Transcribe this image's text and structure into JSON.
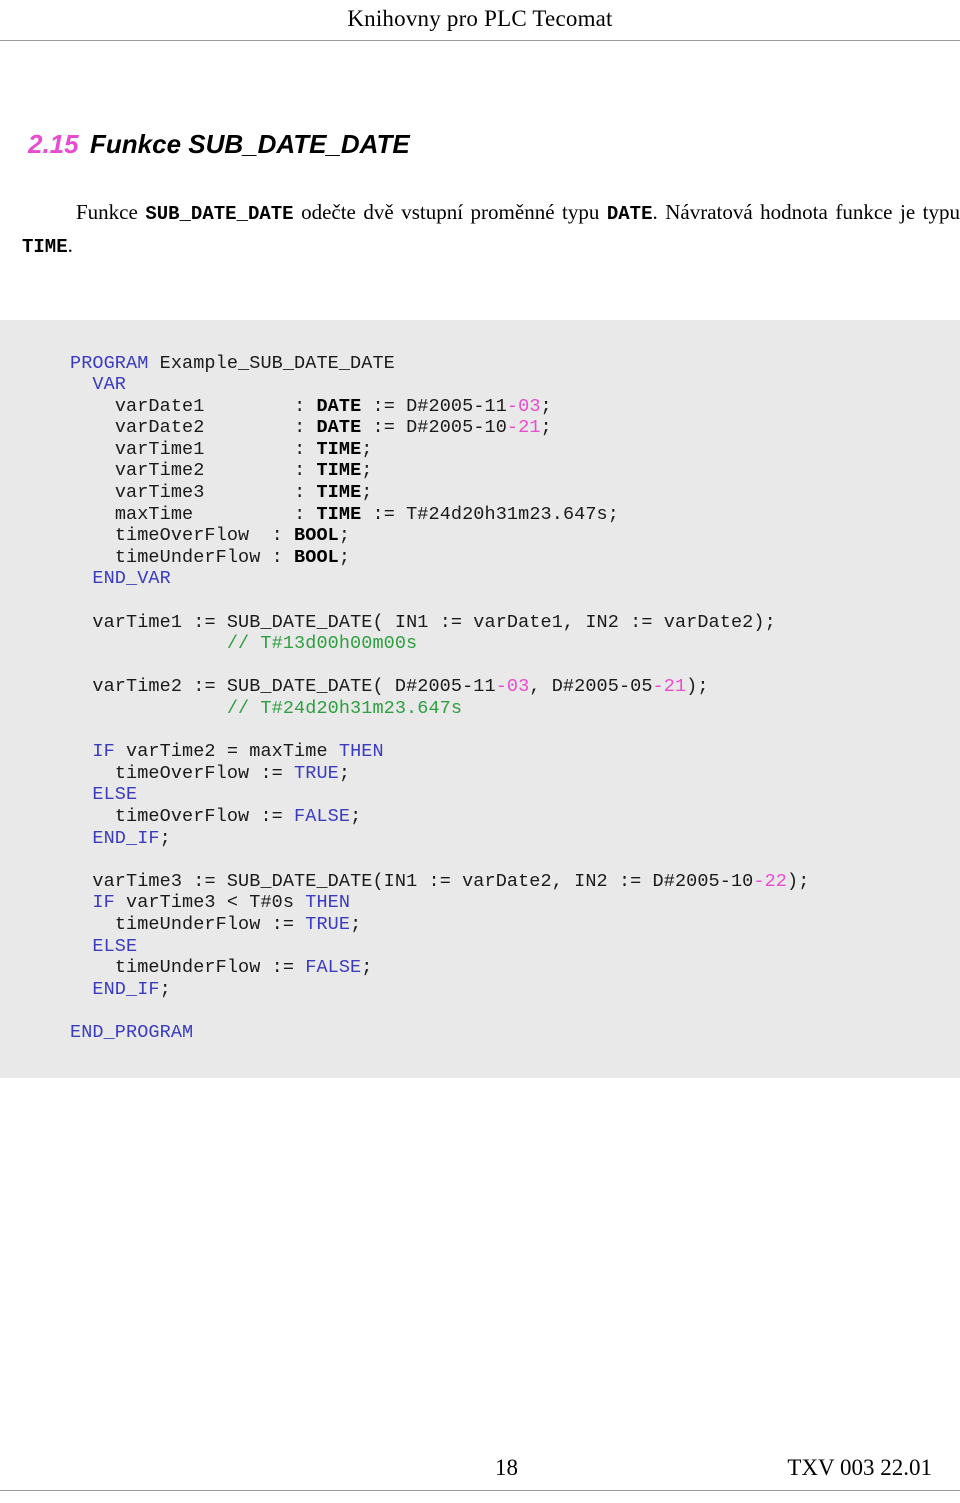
{
  "header": {
    "running_title": "Knihovny pro PLC Tecomat"
  },
  "heading": {
    "number": "2.15",
    "title": "Funkce SUB_DATE_DATE"
  },
  "intro": {
    "t1": "Funkce ",
    "code1": "SUB_DATE_DATE",
    "t2": " odečte dvě vstupní proměnné typu ",
    "code2": "DATE",
    "t3": ". Návratová hodnota funkce je typu ",
    "code3": "TIME",
    "t4": "."
  },
  "code": {
    "language": "Structured Text",
    "colors": {
      "background": "#e9e9e9",
      "keyword": "#3b3bbf",
      "type": "#000000",
      "number": "#e84bd0",
      "comment": "#2f9e41",
      "plain": "#1a1a1a"
    },
    "lines": [
      {
        "id": "l01",
        "text": "PROGRAM Example_SUB_DATE_DATE"
      },
      {
        "id": "l02",
        "text": "  VAR"
      },
      {
        "id": "l03",
        "text": "    varDate1        : DATE := D#2005-11-03;"
      },
      {
        "id": "l04",
        "text": "    varDate2        : DATE := D#2005-10-21;"
      },
      {
        "id": "l05",
        "text": "    varTime1        : TIME;"
      },
      {
        "id": "l06",
        "text": "    varTime2        : TIME;"
      },
      {
        "id": "l07",
        "text": "    varTime3        : TIME;"
      },
      {
        "id": "l08",
        "text": "    maxTime         : TIME := T#24d20h31m23.647s;"
      },
      {
        "id": "l09",
        "text": "    timeOverFlow  : BOOL;"
      },
      {
        "id": "l10",
        "text": "    timeUnderFlow : BOOL;"
      },
      {
        "id": "l11",
        "text": "  END_VAR"
      },
      {
        "id": "l12",
        "text": ""
      },
      {
        "id": "l13",
        "text": "  varTime1 := SUB_DATE_DATE( IN1 := varDate1, IN2 := varDate2);"
      },
      {
        "id": "l14",
        "text": "              // T#13d00h00m00s"
      },
      {
        "id": "l15",
        "text": ""
      },
      {
        "id": "l16",
        "text": "  varTime2 := SUB_DATE_DATE( D#2005-11-03, D#2005-05-21);"
      },
      {
        "id": "l17",
        "text": "              // T#24d20h31m23.647s"
      },
      {
        "id": "l18",
        "text": ""
      },
      {
        "id": "l19",
        "text": "  IF varTime2 = maxTime THEN"
      },
      {
        "id": "l20",
        "text": "    timeOverFlow := TRUE;"
      },
      {
        "id": "l21",
        "text": "  ELSE"
      },
      {
        "id": "l22",
        "text": "    timeOverFlow := FALSE;"
      },
      {
        "id": "l23",
        "text": "  END_IF;"
      },
      {
        "id": "l24",
        "text": ""
      },
      {
        "id": "l25",
        "text": "  varTime3 := SUB_DATE_DATE(IN1 := varDate2, IN2 := D#2005-10-22);"
      },
      {
        "id": "l26",
        "text": "  IF varTime3 < T#0s THEN"
      },
      {
        "id": "l27",
        "text": "    timeUnderFlow := TRUE;"
      },
      {
        "id": "l28",
        "text": "  ELSE"
      },
      {
        "id": "l29",
        "text": "    timeUnderFlow := FALSE;"
      },
      {
        "id": "l30",
        "text": "  END_IF;"
      },
      {
        "id": "l31",
        "text": ""
      },
      {
        "id": "l32",
        "text": "END_PROGRAM"
      }
    ]
  },
  "footer": {
    "page_number": "18",
    "document_code": "TXV 003 22.01"
  }
}
